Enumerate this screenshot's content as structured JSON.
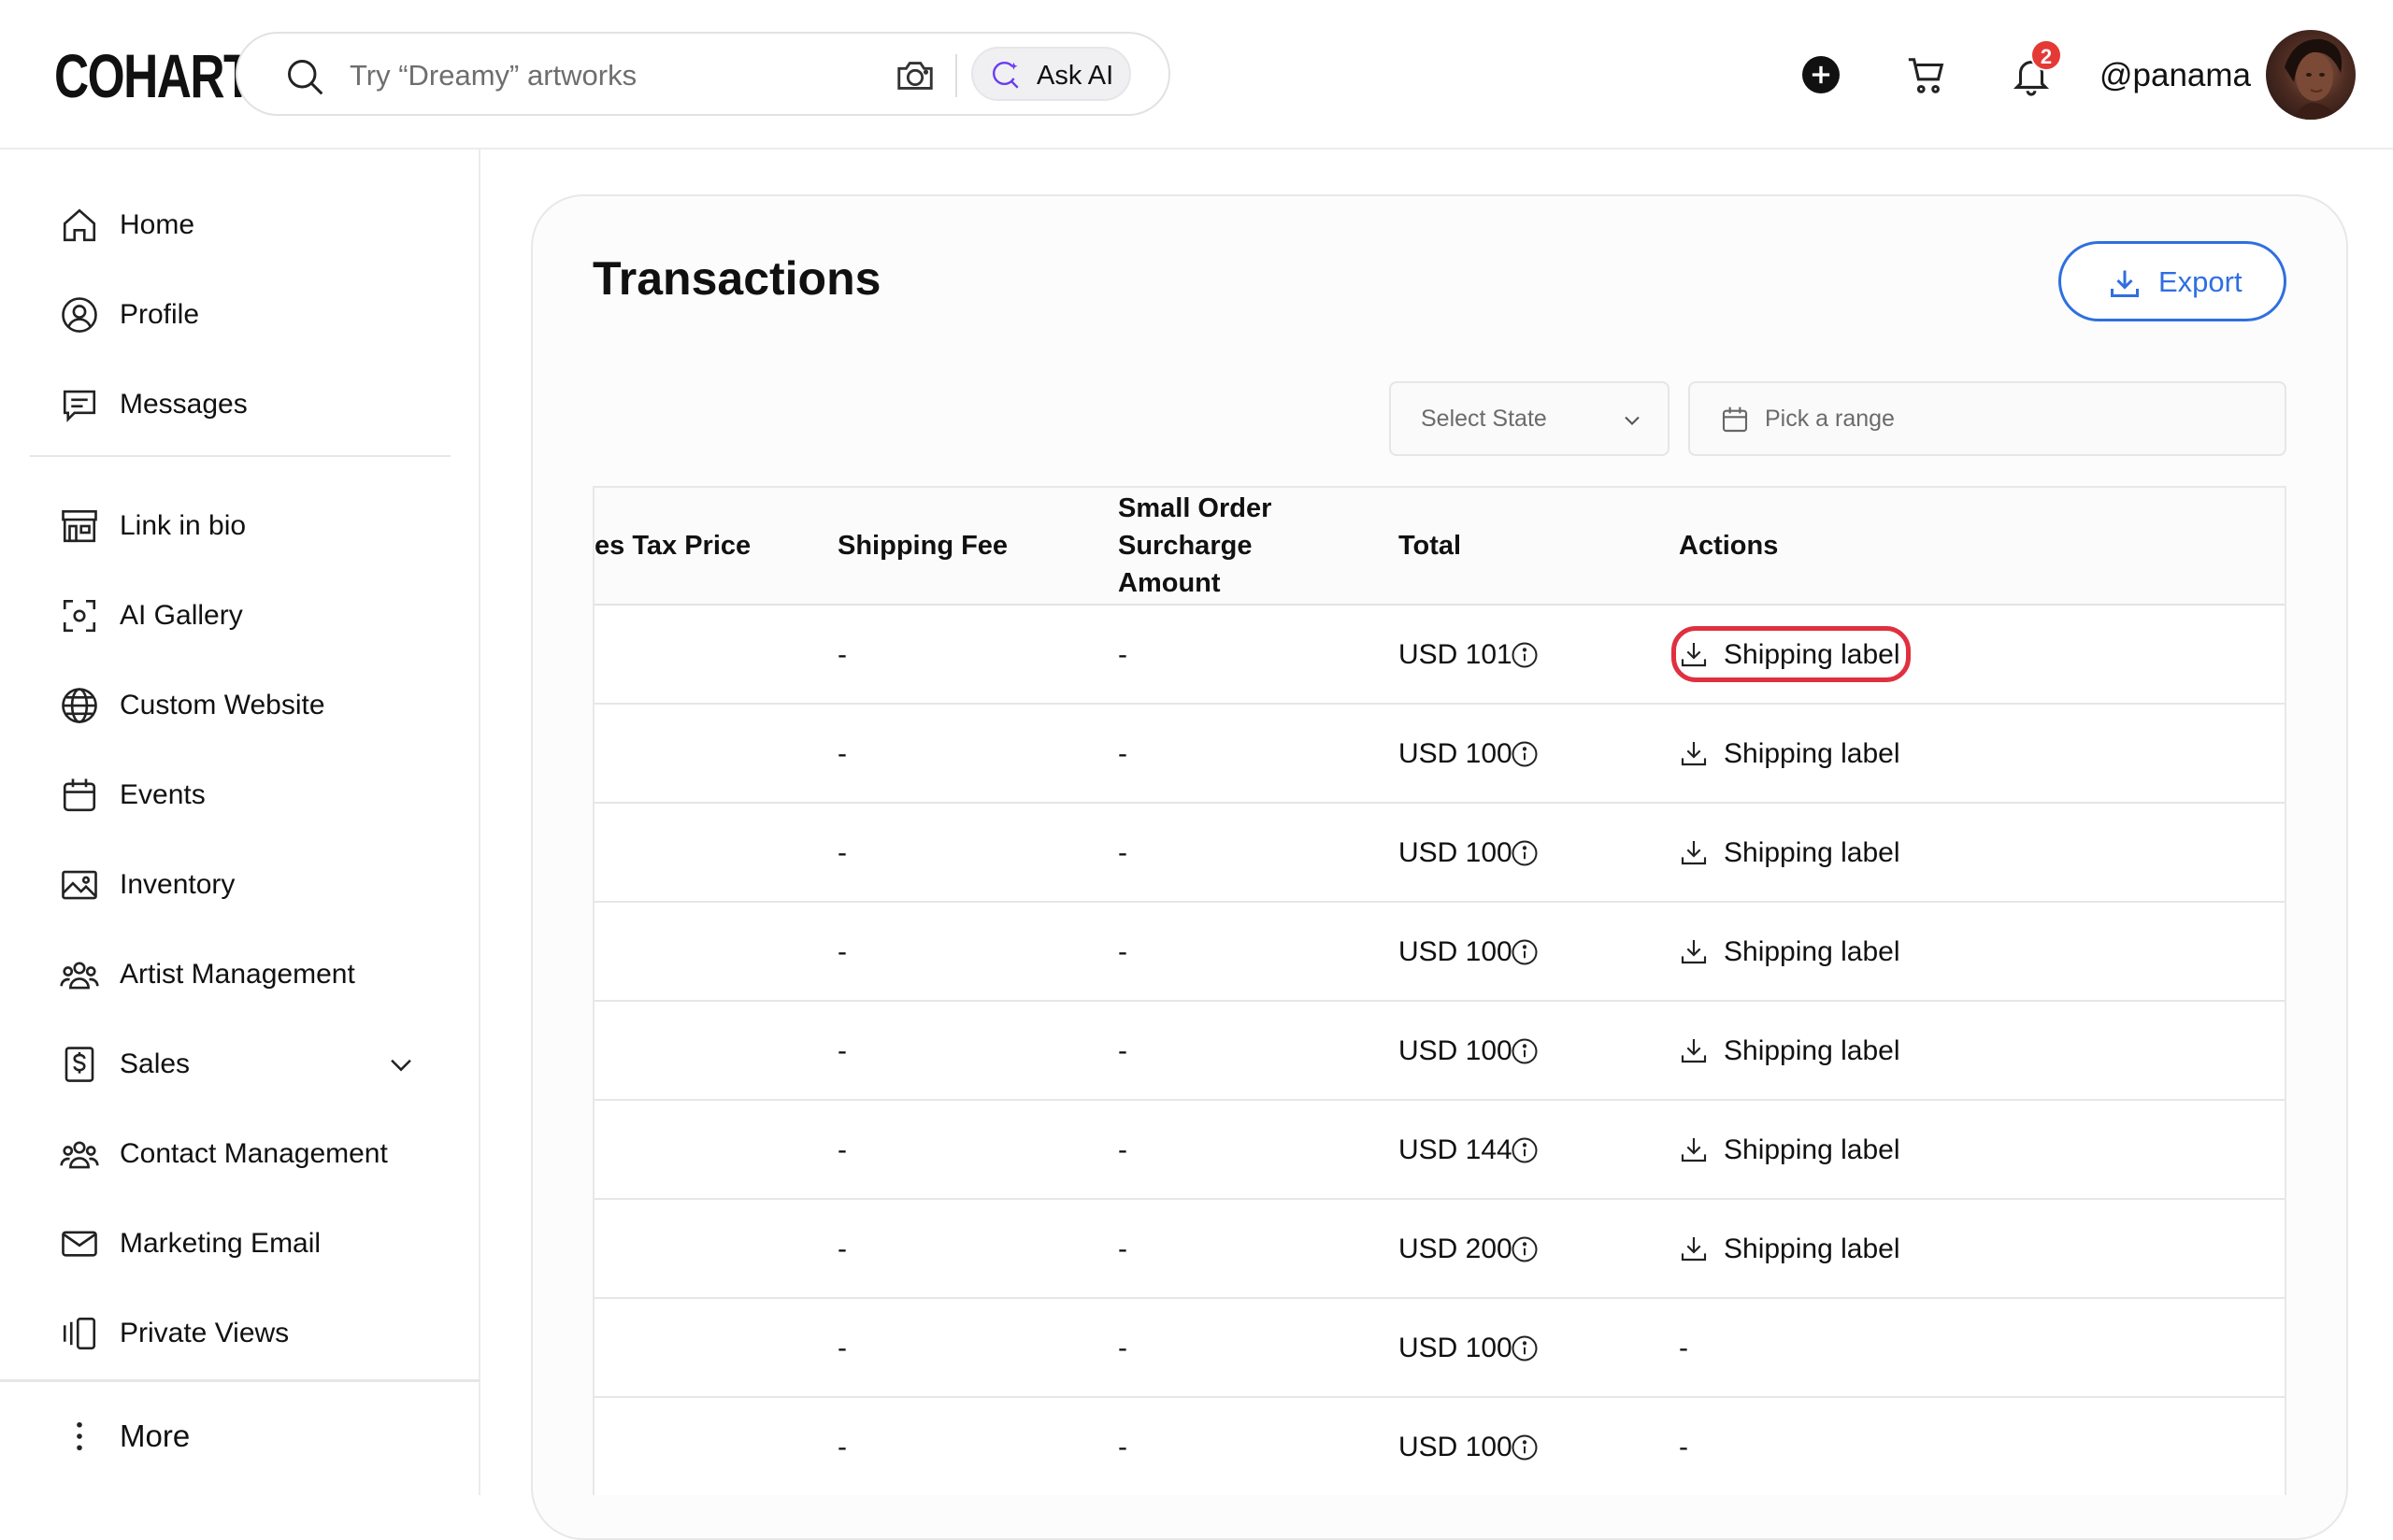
{
  "header": {
    "logo": "COHART",
    "search_placeholder": "Try “Dreamy” artworks",
    "ask_ai_label": "Ask AI",
    "notification_count": "2",
    "username": "@panama"
  },
  "sidebar": {
    "items": [
      {
        "label": "Home",
        "icon": "home-icon"
      },
      {
        "label": "Profile",
        "icon": "profile-icon"
      },
      {
        "label": "Messages",
        "icon": "messages-icon"
      },
      {
        "label": "Link in bio",
        "icon": "storefront-icon"
      },
      {
        "label": "AI Gallery",
        "icon": "scan-icon"
      },
      {
        "label": "Custom Website",
        "icon": "globe-icon"
      },
      {
        "label": "Events",
        "icon": "calendar-icon"
      },
      {
        "label": "Inventory",
        "icon": "image-icon"
      },
      {
        "label": "Artist Management",
        "icon": "users-icon"
      },
      {
        "label": "Sales",
        "icon": "dollar-icon"
      },
      {
        "label": "Contact Management",
        "icon": "users-icon"
      },
      {
        "label": "Marketing Email",
        "icon": "mail-icon"
      },
      {
        "label": "Private Views",
        "icon": "views-icon"
      }
    ],
    "more_label": "More"
  },
  "page": {
    "title": "Transactions",
    "export_label": "Export",
    "select_state_placeholder": "Select State",
    "range_placeholder": "Pick a range"
  },
  "table": {
    "columns": {
      "tax_price": "es Tax Price",
      "shipping_fee": "Shipping Fee",
      "surcharge_line1": "Small Order",
      "surcharge_line2": "Surcharge",
      "surcharge_line3": "Amount",
      "total": "Total",
      "actions": "Actions"
    },
    "rows": [
      {
        "shipping_fee": "-",
        "surcharge": "-",
        "total": "USD 101",
        "action": "Shipping label"
      },
      {
        "shipping_fee": "-",
        "surcharge": "-",
        "total": "USD 100",
        "action": "Shipping label"
      },
      {
        "shipping_fee": "-",
        "surcharge": "-",
        "total": "USD 100",
        "action": "Shipping label"
      },
      {
        "shipping_fee": "-",
        "surcharge": "-",
        "total": "USD 100",
        "action": "Shipping label"
      },
      {
        "shipping_fee": "-",
        "surcharge": "-",
        "total": "USD 100",
        "action": "Shipping label"
      },
      {
        "shipping_fee": "-",
        "surcharge": "-",
        "total": "USD 144",
        "action": "Shipping label"
      },
      {
        "shipping_fee": "-",
        "surcharge": "-",
        "total": "USD 200",
        "action": "Shipping label"
      },
      {
        "shipping_fee": "-",
        "surcharge": "-",
        "total": "USD 100",
        "action": "-"
      },
      {
        "shipping_fee": "-",
        "surcharge": "-",
        "total": "USD 100",
        "action": "-"
      }
    ]
  },
  "colors": {
    "accent": "#2f6fe0",
    "highlight": "#e0303f",
    "badge": "#e53935"
  }
}
